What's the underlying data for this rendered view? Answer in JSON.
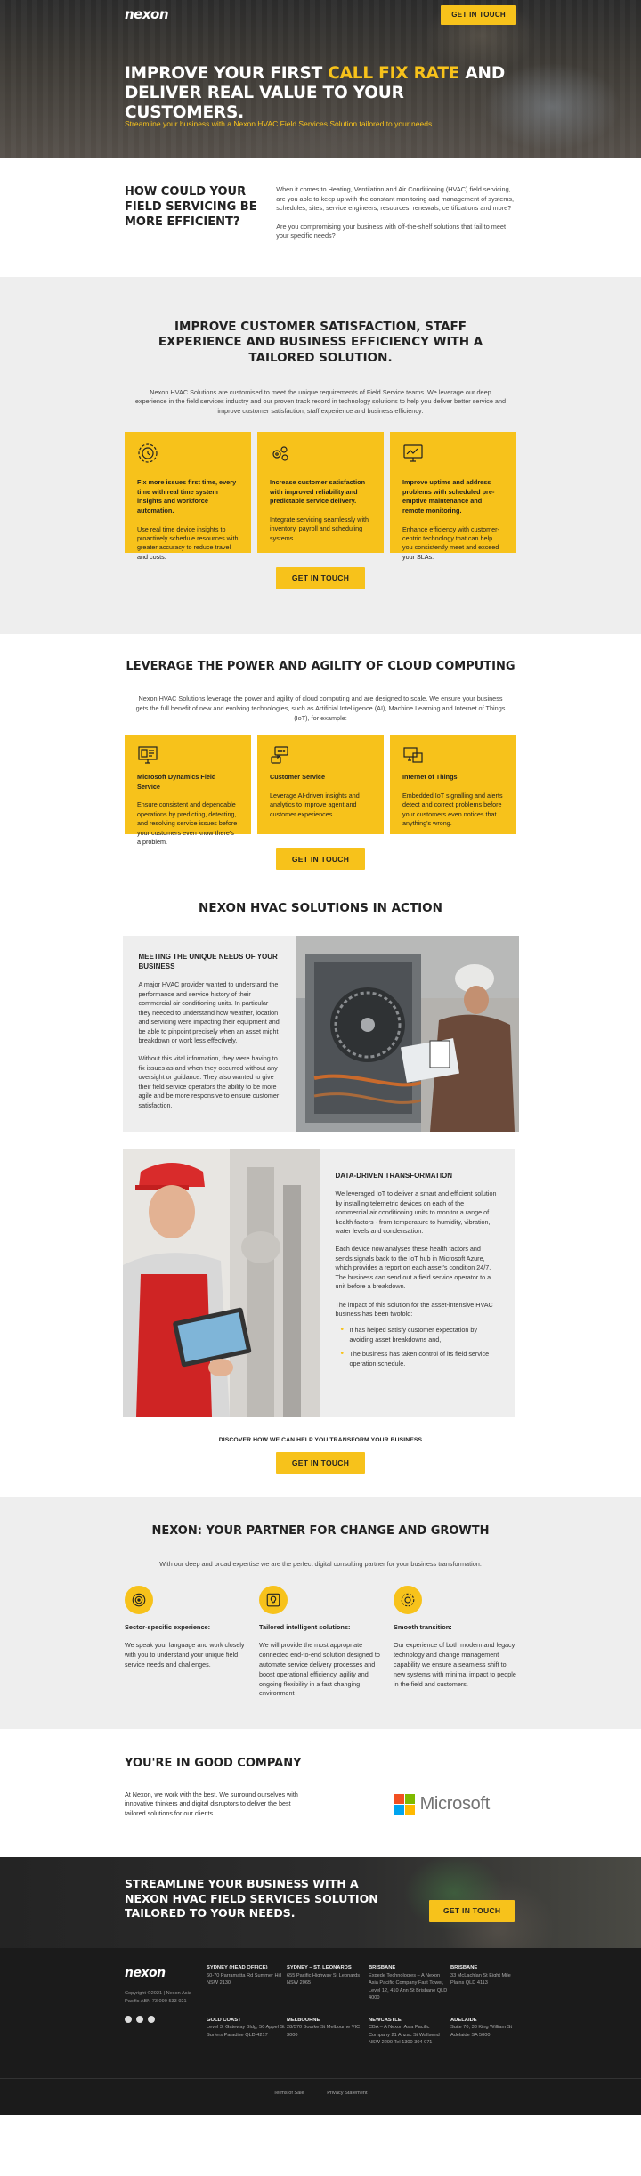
{
  "brand": {
    "logo_text": "nexon"
  },
  "hero": {
    "cta_label": "GET IN TOUCH",
    "title_part1": "IMPROVE YOUR FIRST ",
    "title_highlight": "CALL FIX RATE",
    "title_part2": " AND DELIVER REAL VALUE TO YOUR CUSTOMERS.",
    "subtitle": "Streamline your business with a Nexon HVAC Field Services Solution tailored to your needs."
  },
  "intro": {
    "heading": "HOW COULD YOUR FIELD SERVICING BE MORE EFFICIENT?",
    "para1": "When it comes to  Heating, Ventilation and Air Conditioning (HVAC) field servicing, are you able to keep up with the constant monitoring and management of systems, schedules, sites, service engineers, resources, renewals, certifications and more?",
    "para2": "Are you compromising your business with off-the-shelf solutions that fail to meet your specific needs?"
  },
  "customer": {
    "title": "IMPROVE CUSTOMER SATISFACTION, STAFF EXPERIENCE AND BUSINESS EFFICIENCY WITH A TAILORED SOLUTION.",
    "lead": "Nexon HVAC Solutions are customised to meet the unique requirements of Field Service teams. We leverage our deep experience in the field services industry and our proven track record in technology solutions to help you deliver better service and improve customer satisfaction, staff experience and business efficiency:",
    "cards": [
      {
        "icon": "gear-clock-icon",
        "heading": "Fix more issues first time, every time with real time system insights and workforce automation.",
        "text": "Use real time device insights to proactively schedule resources with greater accuracy to reduce travel and costs."
      },
      {
        "icon": "gears-icon",
        "heading": "Increase customer satisfaction with improved reliability and predictable service delivery.",
        "text": "Integrate servicing seamlessly with inventory, payroll and scheduling systems."
      },
      {
        "icon": "monitor-chart-icon",
        "heading": "Improve uptime and address problems with scheduled pre-emptive maintenance and remote monitoring.",
        "text": "Enhance efficiency with customer-centric technology that can help you consistently meet and exceed your SLAs."
      }
    ],
    "cta_label": "GET IN TOUCH"
  },
  "cloud": {
    "title": "LEVERAGE THE POWER AND AGILITY OF CLOUD COMPUTING",
    "lead": "Nexon HVAC Solutions leverage the power and agility of cloud computing and are designed to scale. We ensure your business gets the full benefit of new and evolving technologies, such as Artificial Intelligence (AI), Machine Learning and Internet of Things (IoT), for example:",
    "cards": [
      {
        "icon": "dashboard-icon",
        "heading": "Microsoft Dynamics Field Service",
        "text": "Ensure consistent and dependable operations by predicting, detecting, and resolving service issues before your customers even know there's a problem."
      },
      {
        "icon": "chat-icon",
        "heading": "Customer Service",
        "text": "Leverage AI-driven insights and analytics to improve agent and customer experiences."
      },
      {
        "icon": "network-icon",
        "heading": "Internet of Things",
        "text": "Embedded IoT signalling and alerts detect and correct problems before your customers even notices that anything's wrong."
      }
    ],
    "cta_label": "GET IN TOUCH"
  },
  "action": {
    "title": "NEXON HVAC SOLUTIONS IN ACTION",
    "panel1": {
      "heading": "MEETING THE UNIQUE NEEDS OF YOUR BUSINESS",
      "para1": "A major HVAC provider wanted to understand the performance and service history of their commercial air conditioning units. In particular they needed to understand how weather, location and servicing were impacting their equipment and be able to pinpoint precisely when an asset might breakdown or work less effectively.",
      "para2": "Without this vital information, they were having to fix issues as and when they occurred without any oversight or guidance. They also wanted to give their field service operators the ability to be more agile and be more responsive to ensure customer satisfaction."
    },
    "panel2": {
      "heading": "DATA-DRIVEN TRANSFORMATION",
      "para1": "We leveraged  IoT to deliver a smart and efficient solution by installing telemetric devices on each of the commercial air conditioning units to monitor a range of health factors - from temperature to humidity, vibration, water levels and condensation.",
      "para2": "Each device now analyses these health factors and sends signals back to the IoT hub in Microsoft Azure, which provides a report on each asset's condition 24/7. The business can send out a field service operator to a unit before a breakdown.",
      "para3": "The impact of this solution for the asset-intensive HVAC business has been twofold:",
      "bullets": [
        "It has helped satisfy customer expectation by avoiding asset breakdowns and,",
        "The business has taken control of its field service operation schedule."
      ]
    },
    "discover": "DISCOVER HOW WE CAN HELP YOU TRANSFORM YOUR BUSINESS",
    "cta_label": "GET IN TOUCH"
  },
  "partner": {
    "title": "NEXON: YOUR PARTNER FOR CHANGE AND GROWTH",
    "lead": "With our deep and broad expertise we are the perfect digital consulting partner for your business transformation:",
    "cols": [
      {
        "icon": "target-icon",
        "heading": "Sector-specific experience:",
        "text": "We speak your language and work closely with you to understand your unique field service needs and challenges."
      },
      {
        "icon": "lightbulb-icon",
        "heading": "Tailored intelligent solutions:",
        "text": "We will provide the most appropriate connected end-to-end solution designed to automate service delivery processes and boost operational efficiency, agility and ongoing flexibility in a fast changing environment"
      },
      {
        "icon": "transition-icon",
        "heading": "Smooth transition:",
        "text": "Our experience of both modern and legacy technology and change management capability we ensure a seamless shift to new systems with minimal impact to people in the field and customers."
      }
    ]
  },
  "company": {
    "heading": "YOU'RE IN GOOD COMPANY",
    "text": "At Nexon, we work with the best. We surround ourselves with innovative thinkers and digital disruptors to deliver the best tailored solutions for our clients.",
    "partner_name": "Microsoft",
    "colors": [
      "#f25022",
      "#7fba00",
      "#00a4ef",
      "#ffb900"
    ]
  },
  "cta_band": {
    "title": "STREAMLINE YOUR BUSINESS WITH A NEXON HVAC FIELD SERVICES SOLUTION TAILORED TO YOUR NEEDS.",
    "cta_label": "GET IN TOUCH"
  },
  "footer": {
    "copyright": "Copyright ©2021 | Nexon Asia Pacific ABN 73 090 533 921",
    "offices": [
      {
        "name": "SYDNEY (HEAD OFFICE)",
        "address": "60-70 Parramatta Rd Summer Hill NSW 2130"
      },
      {
        "name": "SYDNEY – ST. LEONARDS",
        "address": "655 Pacific Highway St Leonards NSW 2065"
      },
      {
        "name": "BRISBANE",
        "address": "Expede Technologies – A Nexon Asia Pacific Company Fast Tower, Level 12, 410 Ann St Brisbane QLD 4000"
      },
      {
        "name": "BRISBANE",
        "address": "33 McLachlan St Eight Mile Plains QLD 4113"
      },
      {
        "name": "GOLD COAST",
        "address": "Level 3, Gateway Bldg, 50 Appel St Surfers Paradise QLD 4217"
      },
      {
        "name": "MELBOURNE",
        "address": "28/570 Bourke St Melbourne VIC 3000"
      },
      {
        "name": "NEWCASTLE",
        "address": "CBA – A Nexon Asia Pacific Company 21 Anzac St Wallsend NSW 2290 Tel 1300 304 071"
      },
      {
        "name": "ADELAIDE",
        "address": "Suite 70, 33 King William St Adelaide SA 5000"
      }
    ],
    "legal": [
      "Terms of Sale",
      "Privacy Statement"
    ]
  }
}
